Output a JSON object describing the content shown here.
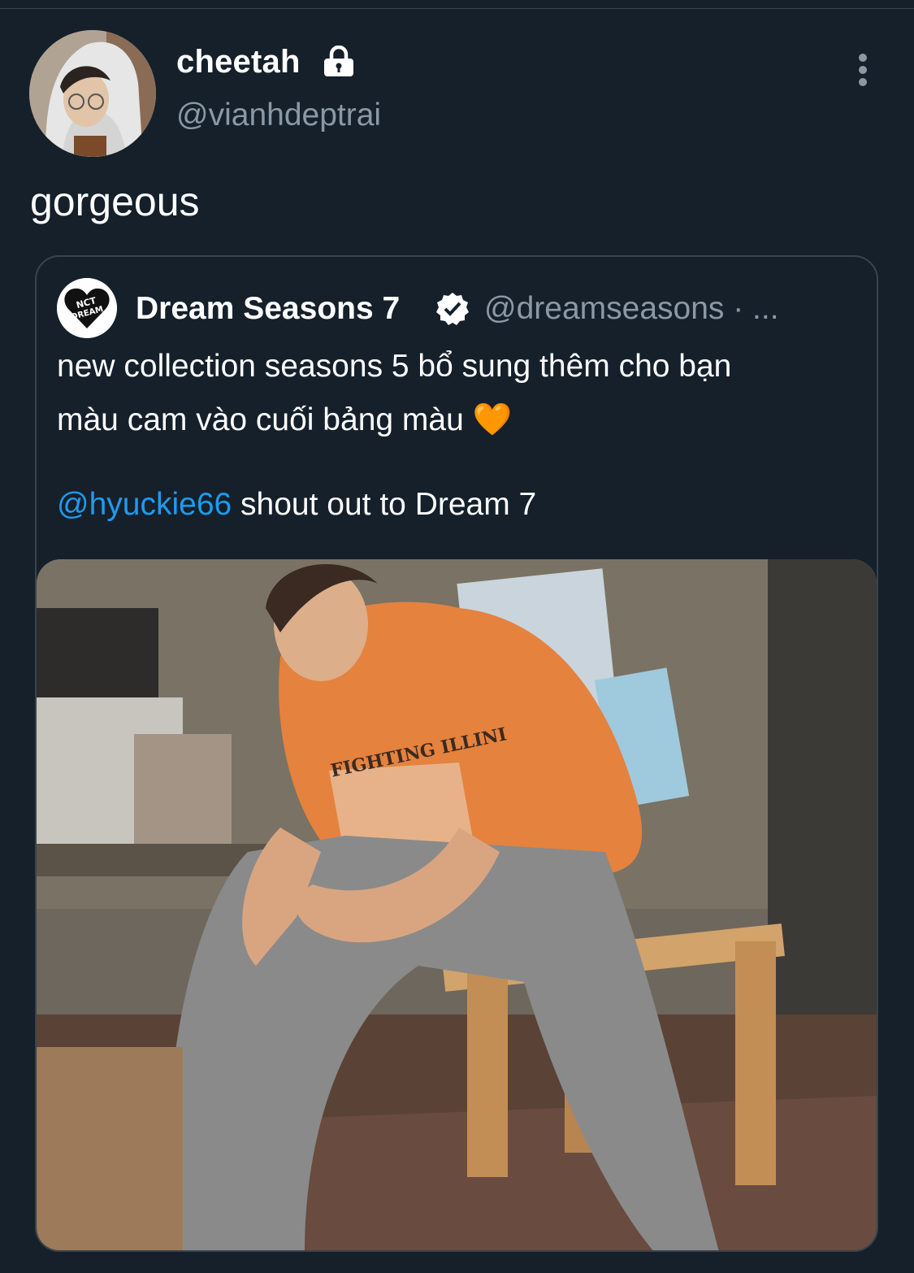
{
  "author": {
    "display_name": "cheetah",
    "handle": "@vianhdeptrai",
    "protected": true,
    "avatar_icon": "profile-photo"
  },
  "tweet": {
    "text": "gorgeous"
  },
  "quoted": {
    "display_name": "Dream Seasons 7",
    "verified": true,
    "handle_meta": "@dreamseasons · ...",
    "avatar_logo_text": "NCT DREAM",
    "line1": "new collection seasons 5 bổ sung thêm cho bạn",
    "line2": "màu cam vào  cuối bảng màu 🧡",
    "mention": "@hyuckie66",
    "line3_rest": " shout out to Dream 7",
    "shirt_text": "FIGHTING ILLINI"
  },
  "colors": {
    "background": "#15202b",
    "secondary_text": "#8b98a5",
    "link": "#1d9bf0",
    "border": "#38444d"
  }
}
